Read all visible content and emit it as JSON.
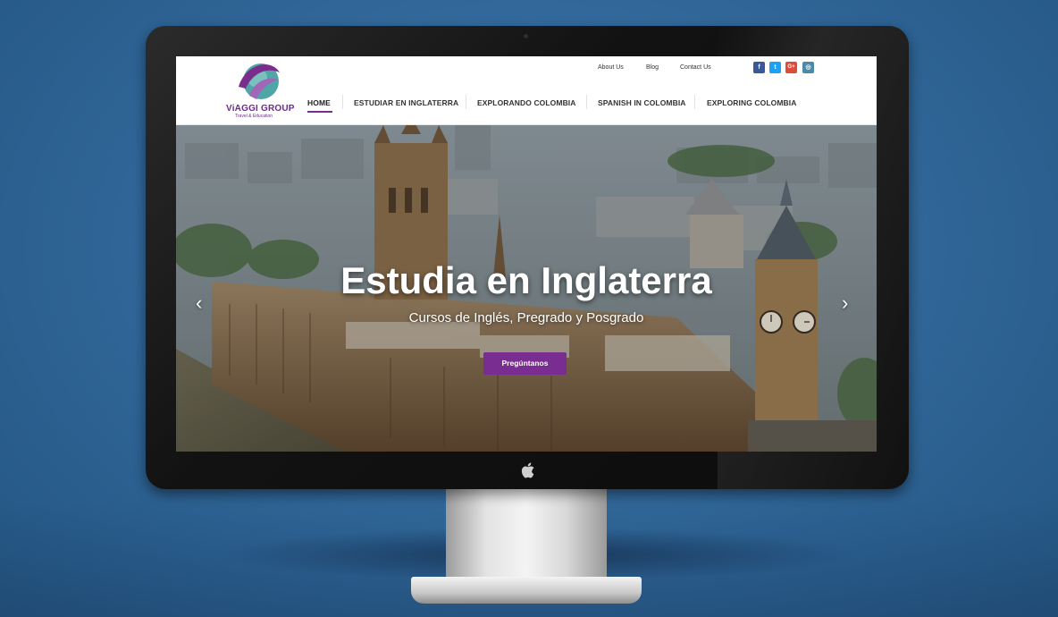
{
  "site": {
    "logo": {
      "title": "ViAGGI GROUP",
      "subtitle": "Travel & Education"
    },
    "top_links": [
      "About Us",
      "Blog",
      "Contact Us"
    ],
    "social": [
      {
        "label": "f",
        "icon": "facebook-icon",
        "color": "#3b5998"
      },
      {
        "label": "t",
        "icon": "twitter-icon",
        "color": "#1da1f2"
      },
      {
        "label": "G+",
        "icon": "google-plus-icon",
        "color": "#dd4b39"
      },
      {
        "label": "◎",
        "icon": "instagram-icon",
        "color": "#4e8aa8"
      }
    ],
    "menu": [
      "HOME",
      "ESTUDIAR EN INGLATERRA",
      "EXPLORANDO COLOMBIA",
      "SPANISH IN COLOMBIA",
      "EXPLORING COLOMBIA"
    ],
    "active_menu": "HOME",
    "accent_color": "#7a2d90"
  },
  "hero": {
    "title": "Estudia en Inglaterra",
    "subtitle": "Cursos de Inglés, Pregrado y Posgrado",
    "cta": "Pregúntanos",
    "prev": "‹",
    "next": "›"
  }
}
